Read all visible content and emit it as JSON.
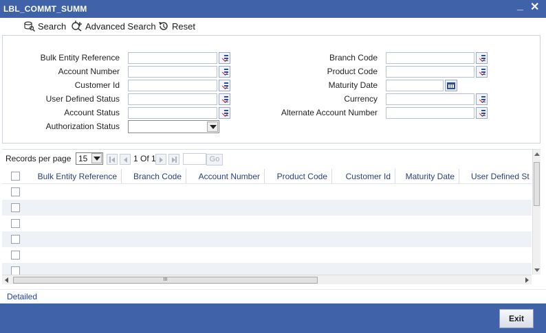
{
  "window": {
    "title": "LBL_COMMT_SUMM",
    "minimize_icon": "minimize-icon",
    "close_icon": "close-icon"
  },
  "toolbar": {
    "search_label": "Search",
    "advanced_search_label": "Advanced Search",
    "reset_label": "Reset"
  },
  "criteria": {
    "bulk_entity_reference": "Bulk Entity Reference",
    "account_number": "Account Number",
    "customer_id": "Customer Id",
    "user_defined_status": "User Defined Status",
    "account_status": "Account Status",
    "authorization_status": "Authorization Status",
    "branch_code": "Branch Code",
    "product_code": "Product Code",
    "maturity_date": "Maturity Date",
    "currency": "Currency",
    "alternate_account_number": "Alternate Account Number"
  },
  "pager": {
    "records_per_page_label": "Records per page",
    "records_per_page_value": "15",
    "page_info": "1 Of 1",
    "go_label": "Go"
  },
  "table": {
    "columns": [
      "Bulk Entity Reference",
      "Branch Code",
      "Account Number",
      "Product Code",
      "Customer Id",
      "Maturity Date",
      "User Defined St"
    ]
  },
  "scroll": {
    "thumb_grip": "III"
  },
  "footer": {
    "detailed_label": "Detailed",
    "exit_label": "Exit"
  },
  "colors": {
    "titlebar": "#3f62a8",
    "header_text": "#2a3f7a",
    "link": "#2740a0"
  }
}
